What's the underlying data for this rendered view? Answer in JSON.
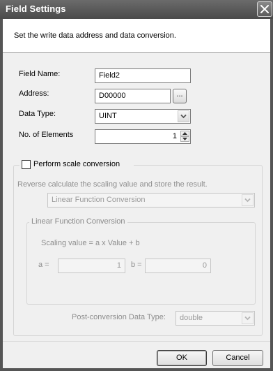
{
  "dialog": {
    "title": "Field Settings",
    "description": "Set the write data address and data conversion."
  },
  "form": {
    "field_name": {
      "label": "Field Name:",
      "value": "Field2"
    },
    "address": {
      "label": "Address:",
      "value": "D00000",
      "browse_label": "..."
    },
    "data_type": {
      "label": "Data Type:",
      "value": "UINT"
    },
    "num_elements": {
      "label": "No. of Elements",
      "value": "1"
    }
  },
  "scale": {
    "checkbox_label": "Perform scale conversion",
    "checked": false,
    "reverse_text": "Reverse calculate the scaling value and store the result.",
    "conversion_type": "Linear Function Conversion",
    "group_title": "Linear Function Conversion",
    "formula": "Scaling value = a x Value + b",
    "a_label": "a =",
    "a_value": "1",
    "b_label": "b =",
    "b_value": "0",
    "post_label": "Post-conversion Data Type:",
    "post_value": "double"
  },
  "buttons": {
    "ok": "OK",
    "cancel": "Cancel"
  }
}
